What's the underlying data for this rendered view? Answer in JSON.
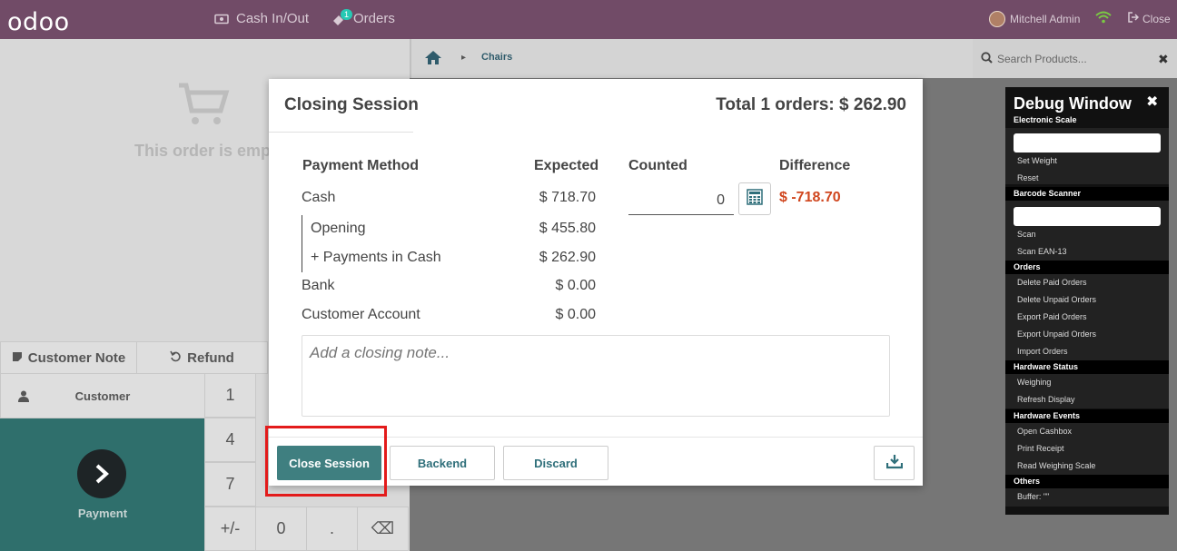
{
  "topbar": {
    "logo": "odoo",
    "cash_in_out": "Cash In/Out",
    "orders": "Orders",
    "orders_badge": "1",
    "user": "Mitchell Admin",
    "close": "Close"
  },
  "order_panel": {
    "empty_text": "This order is empty",
    "customer_note": "Customer Note",
    "refund": "Refund",
    "customer": "Customer",
    "payment": "Payment",
    "numpad": [
      "1",
      "4",
      "7",
      "+/-",
      "0",
      ".",
      "⌫"
    ]
  },
  "products": {
    "breadcrumb_category": "Chairs",
    "search_placeholder": "Search Products..."
  },
  "debug": {
    "title": "Debug Window",
    "sections": {
      "electronic_scale": "Electronic Scale",
      "barcode_scanner": "Barcode Scanner",
      "orders": "Orders",
      "hardware_status": "Hardware Status",
      "hardware_events": "Hardware Events",
      "others": "Others"
    },
    "items": {
      "set_weight": "Set Weight",
      "reset": "Reset",
      "scan": "Scan",
      "scan_ean13": "Scan EAN-13",
      "delete_paid": "Delete Paid Orders",
      "delete_unpaid": "Delete Unpaid Orders",
      "export_paid": "Export Paid Orders",
      "export_unpaid": "Export Unpaid Orders",
      "import_orders": "Import Orders",
      "weighing": "Weighing",
      "refresh_display": "Refresh Display",
      "open_cashbox": "Open Cashbox",
      "print_receipt": "Print Receipt",
      "read_weighing_scale": "Read Weighing Scale",
      "buffer": "Buffer: \"\""
    }
  },
  "modal": {
    "title": "Closing Session",
    "total": "Total 1 orders: $ 262.90",
    "headers": {
      "payment_method": "Payment Method",
      "expected": "Expected",
      "counted": "Counted",
      "difference": "Difference"
    },
    "rows": {
      "cash": "Cash",
      "cash_expected": "$ 718.70",
      "opening": "Opening",
      "opening_amount": "$ 455.80",
      "payments_in_cash": "+ Payments in Cash",
      "payments_in_cash_amount": "$ 262.90",
      "bank": "Bank",
      "bank_amount": "$ 0.00",
      "customer_account": "Customer Account",
      "customer_account_amount": "$ 0.00"
    },
    "counted_value": "0",
    "difference_value": "$ -718.70",
    "note_placeholder": "Add a closing note...",
    "buttons": {
      "close_session": "Close Session",
      "backend": "Backend",
      "discard": "Discard"
    }
  },
  "colors": {
    "topbar": "#714B67",
    "primary_button": "#3f7f80",
    "difference_negative": "#d0461e",
    "highlight": "#e31b1b"
  }
}
